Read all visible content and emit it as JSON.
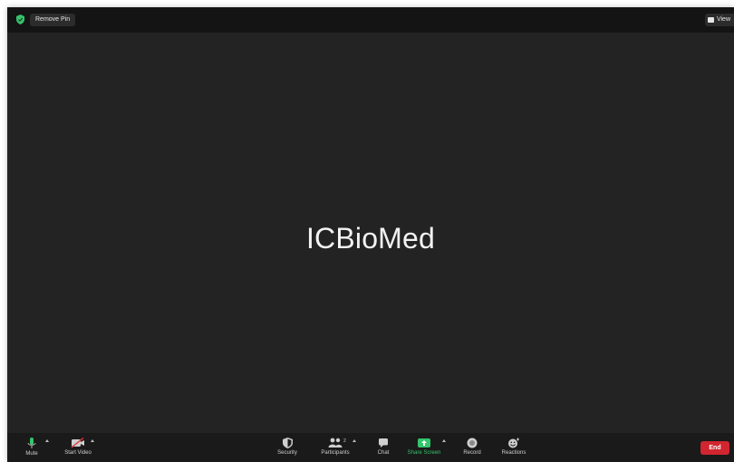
{
  "topbar": {
    "security_badge_color": "#37c26b",
    "remove_pin_label": "Remove Pin",
    "view_label": "View"
  },
  "main": {
    "speaker_name": "ICBioMed"
  },
  "toolbar": {
    "mute_label": "Mute",
    "start_video_label": "Start Video",
    "security_label": "Security",
    "participants_label": "Participants",
    "participants_count": "2",
    "chat_label": "Chat",
    "share_screen_label": "Share Screen",
    "record_label": "Record",
    "reactions_label": "Reactions",
    "end_label": "End",
    "accent_green": "#33c66b",
    "end_color": "#d1262f"
  }
}
